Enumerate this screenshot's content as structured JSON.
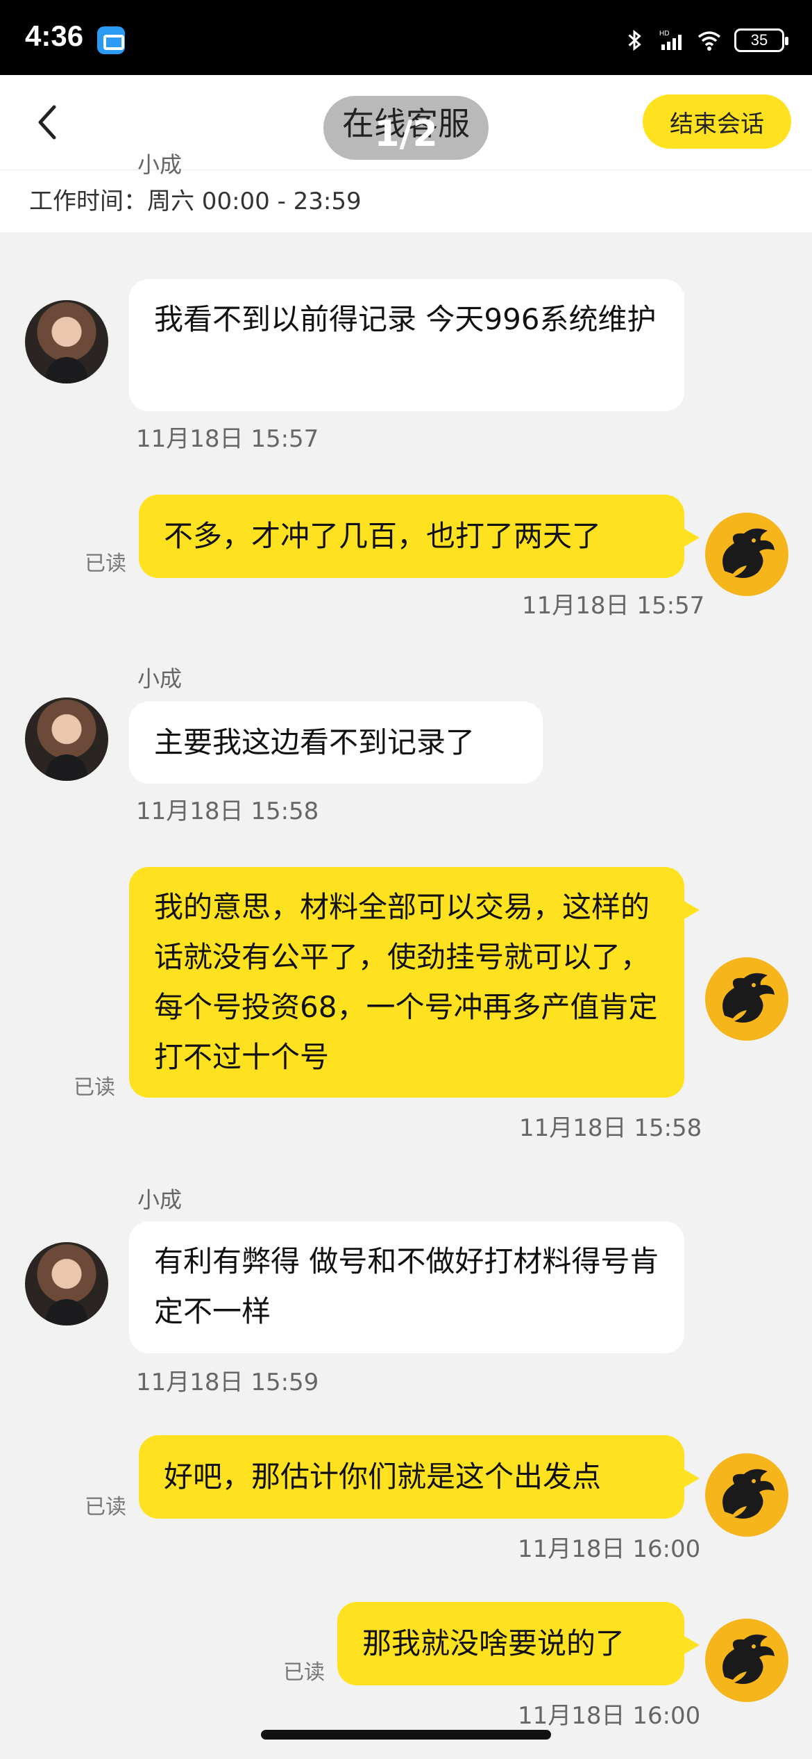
{
  "status_bar": {
    "time": "4:36",
    "battery": "35",
    "icons": [
      "app-icon",
      "bluetooth-icon",
      "hd-signal-icon",
      "wifi-icon",
      "battery-icon"
    ]
  },
  "header": {
    "title": "在线客服",
    "page_counter": "1/2",
    "end_button": "结束会话"
  },
  "work_hours": "工作时间：周六 00:00 - 23:59",
  "colors": {
    "accent_yellow": "#ffe21f",
    "background": "#f2f2f2",
    "incoming_bubble": "#ffffff"
  },
  "messages": [
    {
      "from": "agent",
      "sender": "小成",
      "text": "我看不到以前得记录 今天996系统维护",
      "time": "11月18日 15:57"
    },
    {
      "from": "user",
      "read": "已读",
      "text": "不多，才冲了几百，也打了两天了",
      "time": "11月18日 15:57"
    },
    {
      "from": "agent",
      "sender": "小成",
      "text": "主要我这边看不到记录了",
      "time": "11月18日 15:58"
    },
    {
      "from": "user",
      "read": "已读",
      "text": "我的意思，材料全部可以交易，这样的话就没有公平了，使劲挂号就可以了，每个号投资68，一个号冲再多产值肯定打不过十个号",
      "time": "11月18日 15:58"
    },
    {
      "from": "agent",
      "sender": "小成",
      "text": "有利有弊得 做号和不做好打材料得号肯定不一样",
      "time": "11月18日 15:59"
    },
    {
      "from": "user",
      "read": "已读",
      "text": "好吧，那估计你们就是这个出发点",
      "time": "11月18日 16:00"
    },
    {
      "from": "user",
      "read": "已读",
      "text": "那我就没啥要说的了",
      "time": "11月18日 16:00"
    }
  ]
}
